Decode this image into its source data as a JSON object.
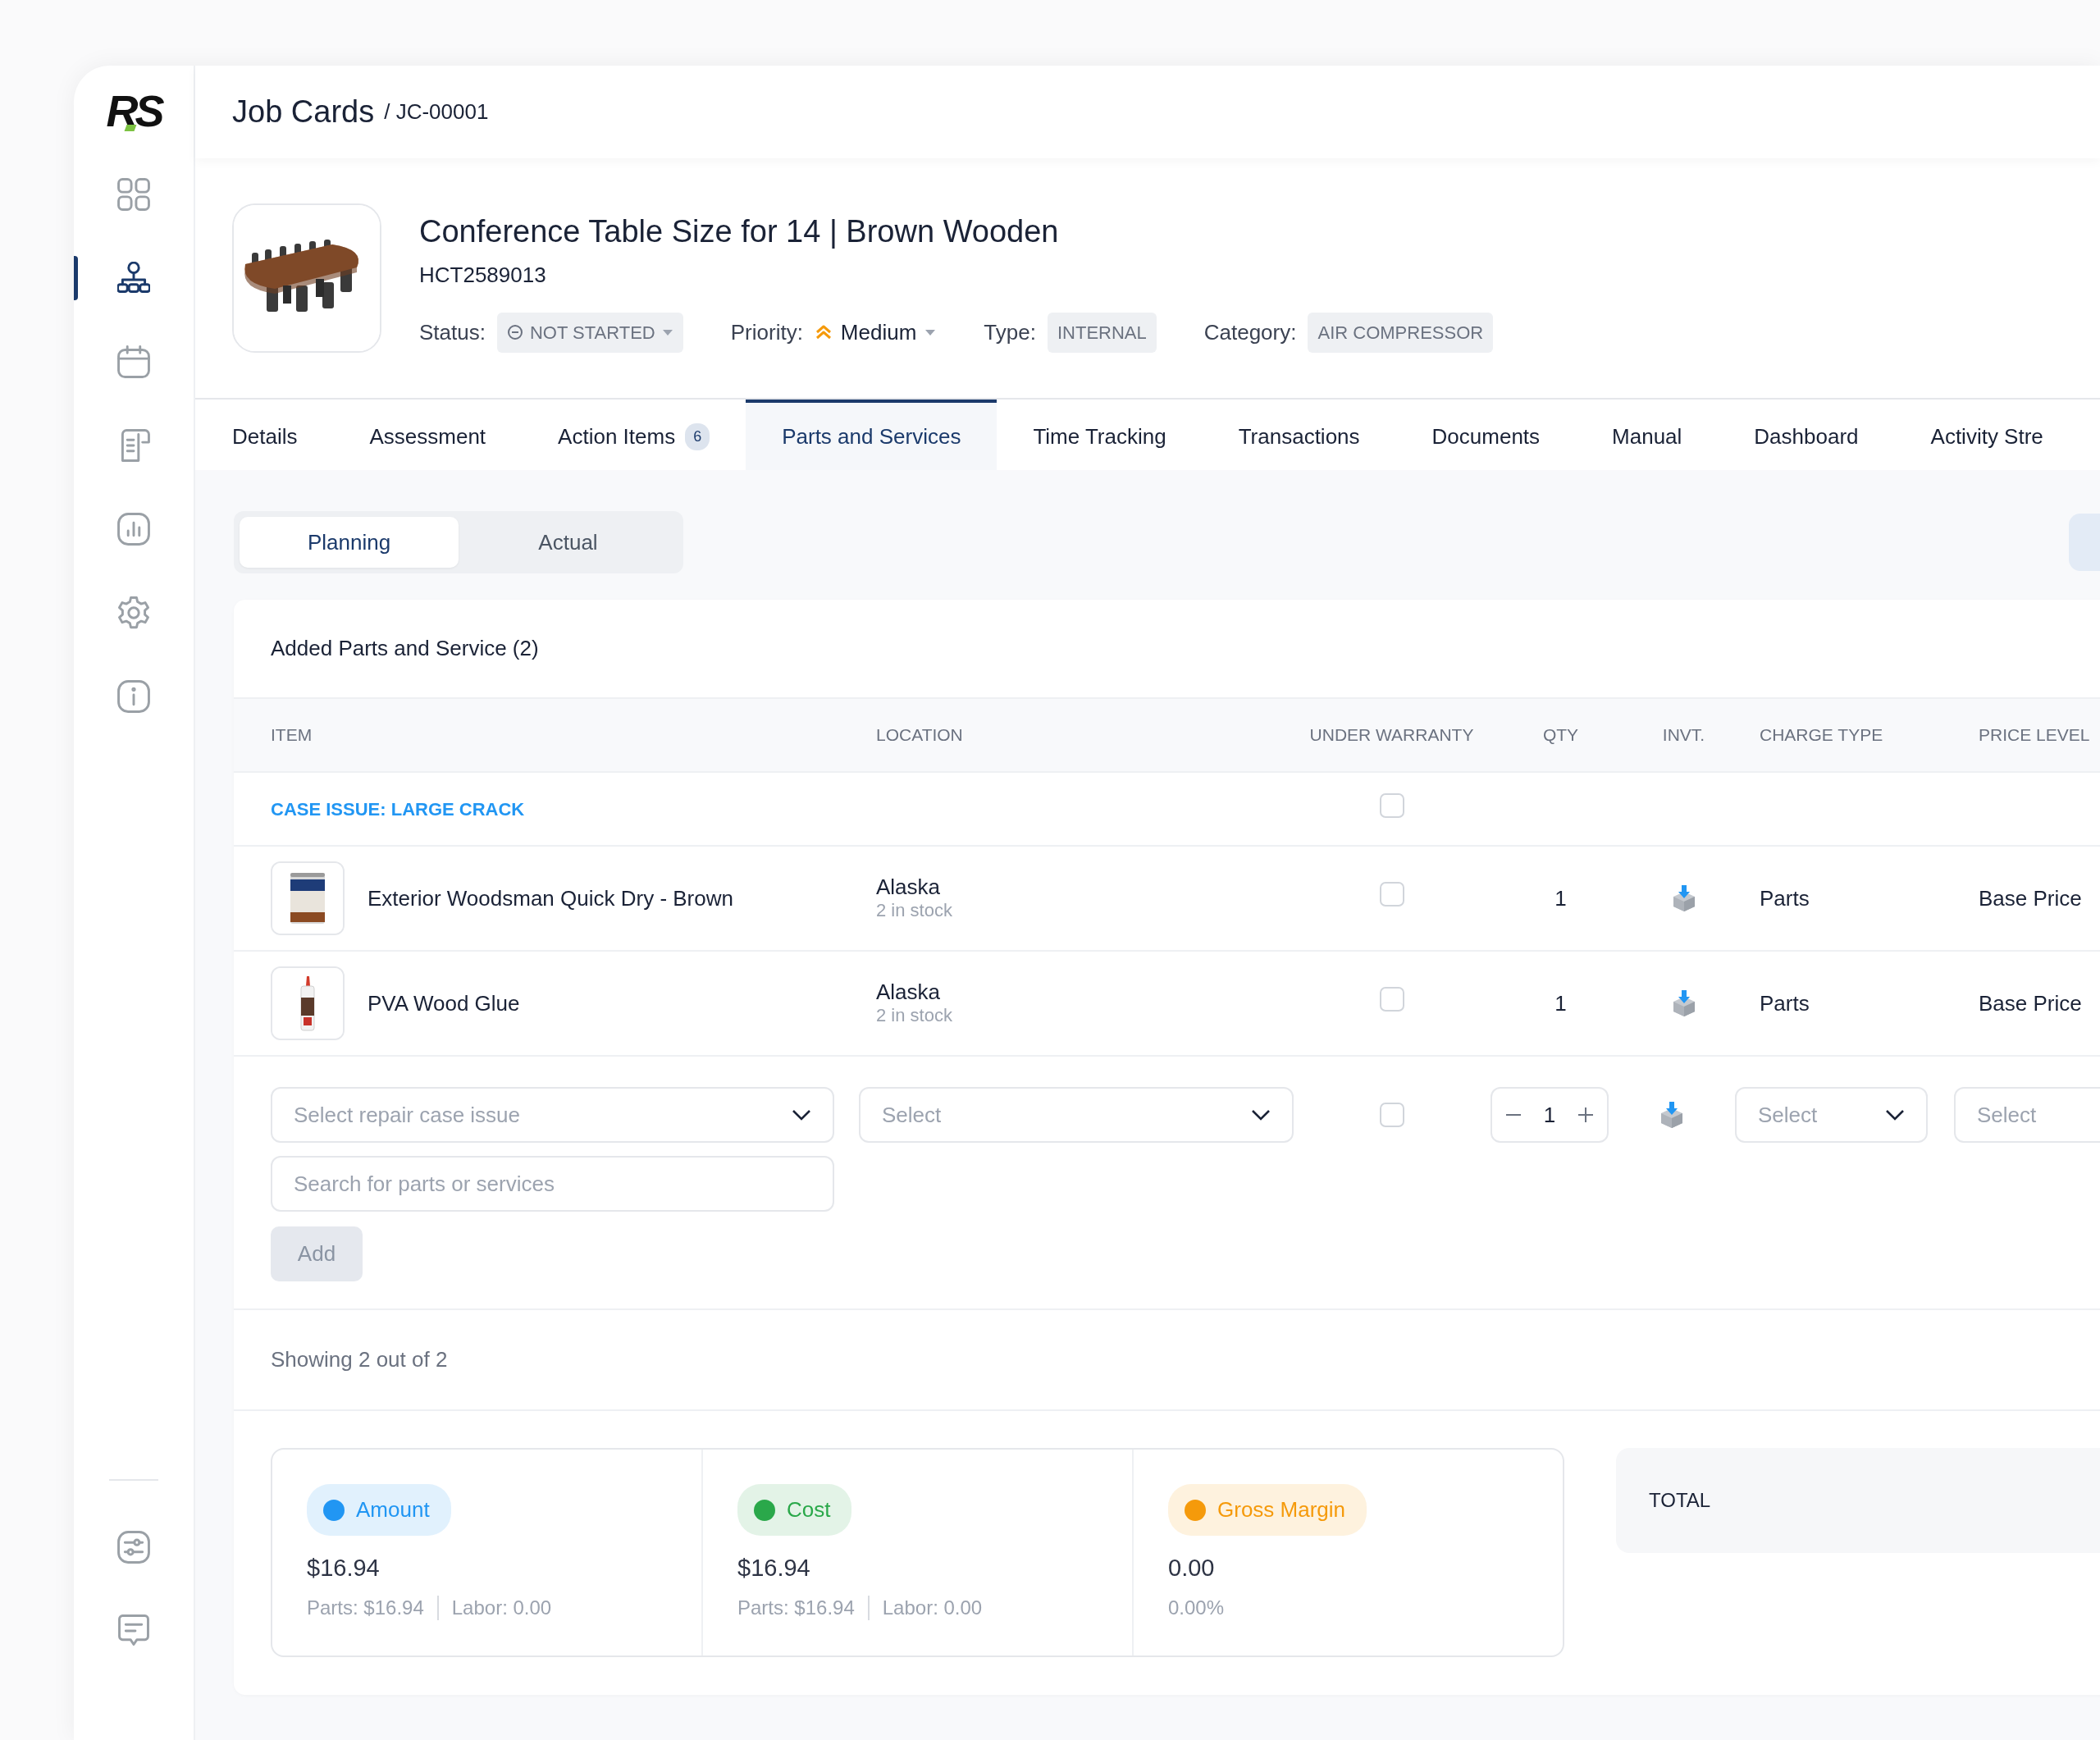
{
  "logo": "RS",
  "sidebar": {
    "items": [
      {
        "kind": "grid",
        "selected": false
      },
      {
        "kind": "hierarchy",
        "selected": true
      },
      {
        "kind": "calendar",
        "selected": false
      },
      {
        "kind": "document",
        "selected": false
      },
      {
        "kind": "chart",
        "selected": false
      },
      {
        "kind": "gear",
        "selected": false
      },
      {
        "kind": "info",
        "selected": false
      }
    ],
    "bottom_items": [
      {
        "kind": "sliders",
        "selected": false
      },
      {
        "kind": "chat",
        "selected": false
      }
    ]
  },
  "header": {
    "title": "Job Cards",
    "crumb": "/ JC-00001"
  },
  "product": {
    "name": "Conference Table Size for 14 | Brown Wooden",
    "code": "HCT2589013",
    "status_label": "Status:",
    "status": "NOT STARTED",
    "priority_label": "Priority:",
    "priority": "Medium",
    "type_label": "Type:",
    "type": "INTERNAL",
    "category_label": "Category:",
    "category": "AIR COMPRESSOR"
  },
  "tabs": [
    {
      "label": "Details",
      "selected": false
    },
    {
      "label": "Assessment",
      "selected": false
    },
    {
      "label": "Action Items",
      "badge": "6",
      "selected": false
    },
    {
      "label": "Parts and Services",
      "selected": true
    },
    {
      "label": "Time Tracking",
      "selected": false
    },
    {
      "label": "Transactions",
      "selected": false
    },
    {
      "label": "Documents",
      "selected": false
    },
    {
      "label": "Manual",
      "selected": false
    },
    {
      "label": "Dashboard",
      "selected": false
    },
    {
      "label": "Activity Stre",
      "selected": false
    }
  ],
  "segments": [
    {
      "label": "Planning",
      "selected": true
    },
    {
      "label": "Actual",
      "selected": false
    }
  ],
  "parts": {
    "title": "Added Parts and Service (2)",
    "columns": [
      "ITEM",
      "LOCATION",
      "UNDER WARRANTY",
      "QTY",
      "INVT.",
      "CHARGE TYPE",
      "PRICE LEVEL"
    ],
    "rows": [
      {
        "kind": "issue",
        "label": "CASE ISSUE: LARGE CRACK",
        "under_warranty": false
      },
      {
        "kind": "item",
        "name": "Exterior Woodsman Quick Dry - Brown",
        "location": "Alaska",
        "stock": "2 in stock",
        "under_warranty": false,
        "qty": "1",
        "charge_type": "Parts",
        "price_level": "Base Price"
      },
      {
        "kind": "item",
        "name": "PVA Wood Glue",
        "location": "Alaska",
        "stock": "2 in stock",
        "under_warranty": false,
        "qty": "1",
        "charge_type": "Parts",
        "price_level": "Base Price"
      }
    ]
  },
  "entry": {
    "issue_placeholder": "Select repair case issue",
    "search_placeholder": "Search for parts or services",
    "location_placeholder": "Select",
    "under_warranty": false,
    "qty": "1",
    "charge_placeholder": "Select",
    "price_placeholder": "Select",
    "add_label": "Add",
    "add_disabled": true
  },
  "footer": "Showing 2 out of 2",
  "summary": [
    {
      "label": "Amount",
      "color": "#2196f3",
      "value": "$16.94",
      "parts": "Parts: $16.94",
      "labor": "Labor: 0.00"
    },
    {
      "label": "Cost",
      "color": "#2aa84a",
      "value": "$16.94",
      "parts": "Parts: $16.94",
      "labor": "Labor: 0.00"
    },
    {
      "label": "Gross Margin",
      "color": "#f59a0b",
      "value": "0.00",
      "percent": "0.00%"
    }
  ],
  "total": {
    "label": "TOTAL"
  }
}
